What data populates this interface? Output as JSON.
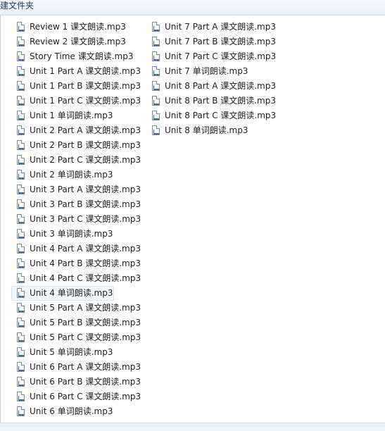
{
  "toolbar": {
    "new_folder_label": "建文件夹"
  },
  "columns": [
    {
      "files": [
        {
          "name": "Review 1 课文朗读.mp3"
        },
        {
          "name": "Review 2 课文朗读.mp3"
        },
        {
          "name": "Story Time 课文朗读.mp3"
        },
        {
          "name": "Unit 1 Part A 课文朗读.mp3"
        },
        {
          "name": "Unit 1 Part B 课文朗读.mp3"
        },
        {
          "name": "Unit 1 Part C 课文朗读.mp3"
        },
        {
          "name": "Unit 1 单词朗读.mp3"
        },
        {
          "name": "Unit 2 Part A 课文朗读.mp3"
        },
        {
          "name": "Unit 2 Part B 课文朗读.mp3"
        },
        {
          "name": "Unit 2 Part C 课文朗读.mp3"
        },
        {
          "name": "Unit 2 单词朗读.mp3"
        },
        {
          "name": "Unit 3 Part A 课文朗读.mp3"
        },
        {
          "name": "Unit 3 Part B 课文朗读.mp3"
        },
        {
          "name": "Unit 3 Part C 课文朗读.mp3"
        },
        {
          "name": "Unit 3 单词朗读.mp3"
        },
        {
          "name": "Unit 4 Part A 课文朗读.mp3"
        },
        {
          "name": "Unit 4 Part B 课文朗读.mp3"
        },
        {
          "name": "Unit 4 Part C 课文朗读.mp3"
        },
        {
          "name": "Unit 4 单词朗读.mp3",
          "selected": true
        },
        {
          "name": "Unit 5 Part A 课文朗读.mp3"
        },
        {
          "name": "Unit 5 Part B 课文朗读.mp3"
        },
        {
          "name": "Unit 5 Part C 课文朗读.mp3"
        },
        {
          "name": "Unit 5 单词朗读.mp3"
        },
        {
          "name": "Unit 6 Part A 课文朗读.mp3"
        },
        {
          "name": "Unit 6 Part B 课文朗读.mp3"
        },
        {
          "name": "Unit 6 Part C 课文朗读.mp3"
        },
        {
          "name": "Unit 6 单词朗读.mp3"
        }
      ]
    },
    {
      "files": [
        {
          "name": "Unit 7 Part A 课文朗读.mp3"
        },
        {
          "name": "Unit 7 Part B 课文朗读.mp3"
        },
        {
          "name": "Unit 7 Part C 课文朗读.mp3"
        },
        {
          "name": "Unit 7 单词朗读.mp3"
        },
        {
          "name": "Unit 8 Part A 课文朗读.mp3"
        },
        {
          "name": "Unit 8 Part B 课文朗读.mp3"
        },
        {
          "name": "Unit 8 Part C 课文朗读.mp3"
        },
        {
          "name": "Unit 8 单词朗读.mp3"
        }
      ]
    }
  ],
  "file_icon": "audio-file-icon",
  "colors": {
    "selection_border": "#d8e6f4",
    "selection_fill": "#f4f8fc",
    "toolbar_text": "#1e395b"
  }
}
